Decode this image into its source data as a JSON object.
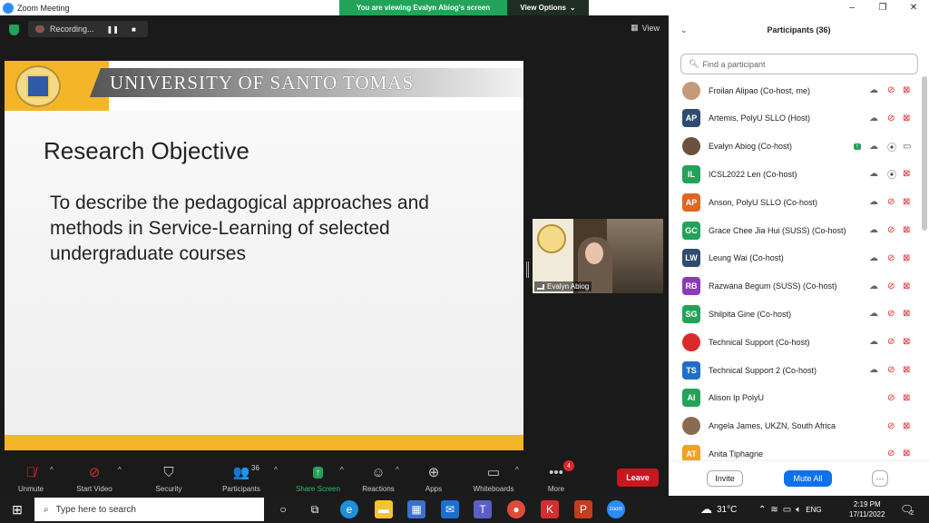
{
  "window": {
    "title": "Zoom Meeting",
    "viewing_banner": "You are viewing Evalyn Abiog's screen",
    "view_options": "View Options",
    "controls": [
      "–",
      "❐",
      "✕"
    ]
  },
  "meeting": {
    "recording_label": "Recording...",
    "view_label": "View"
  },
  "slide": {
    "university": "UNIVERSITY OF SANTO TOMAS",
    "title": "Research Objective",
    "body": "To describe the pedagogical approaches and methods in Service-Learning of selected undergraduate courses"
  },
  "thumbnail": {
    "name": "Evalyn Abiog"
  },
  "toolbar": {
    "unmute": "Unmute",
    "start_video": "Start Video",
    "security": "Security",
    "participants": "Participants",
    "participants_count": "36",
    "share_screen": "Share Screen",
    "reactions": "Reactions",
    "apps": "Apps",
    "whiteboards": "Whiteboards",
    "more": "More",
    "more_badge": "4",
    "leave": "Leave"
  },
  "panel": {
    "title": "Participants (36)",
    "search_placeholder": "Find a participant",
    "invite": "Invite",
    "mute_all": "Mute All",
    "more": "···"
  },
  "participants": [
    {
      "initials": "",
      "name": "Froilan Alipao (Co-host, me)",
      "color": "#c49a7a",
      "photo": true,
      "rec": true,
      "mic": "muted",
      "video": "off"
    },
    {
      "initials": "AP",
      "name": "Artemis, PolyU SLLO (Host)",
      "color": "#2f4b6e",
      "photo": false,
      "rec": true,
      "mic": "muted",
      "video": "off"
    },
    {
      "initials": "",
      "name": "Evalyn Abiog (Co-host)",
      "color": "#6b5040",
      "photo": true,
      "rec": true,
      "mic": "on",
      "video": "on",
      "sharing": true
    },
    {
      "initials": "IL",
      "name": "ICSL2022 Len (Co-host)",
      "color": "#23a35a",
      "photo": false,
      "rec": true,
      "mic": "on",
      "video": "off"
    },
    {
      "initials": "AP",
      "name": "Anson, PolyU SLLO (Co-host)",
      "color": "#e0661e",
      "photo": false,
      "rec": true,
      "mic": "muted",
      "video": "off"
    },
    {
      "initials": "GC",
      "name": "Grace Chee Jia Hui (SUSS) (Co-host)",
      "color": "#23a35a",
      "photo": false,
      "rec": true,
      "mic": "muted",
      "video": "off"
    },
    {
      "initials": "LW",
      "name": "Leung Wai (Co-host)",
      "color": "#2f4b6e",
      "photo": false,
      "rec": true,
      "mic": "muted",
      "video": "off"
    },
    {
      "initials": "RB",
      "name": "Razwana Begum (SUSS) (Co-host)",
      "color": "#8a3ab9",
      "photo": false,
      "rec": true,
      "mic": "muted",
      "video": "off"
    },
    {
      "initials": "SG",
      "name": "Shilpita Gine (Co-host)",
      "color": "#23a35a",
      "photo": false,
      "rec": true,
      "mic": "muted",
      "video": "off"
    },
    {
      "initials": "",
      "name": "Technical Support (Co-host)",
      "color": "#d92b2b",
      "photo": true,
      "rec": true,
      "mic": "muted",
      "video": "off"
    },
    {
      "initials": "TS",
      "name": "Technical Support 2 (Co-host)",
      "color": "#1f6fc8",
      "photo": false,
      "rec": true,
      "mic": "muted",
      "video": "off"
    },
    {
      "initials": "AI",
      "name": "Alison Ip PolyU",
      "color": "#23a35a",
      "photo": false,
      "rec": false,
      "mic": "muted",
      "video": "off"
    },
    {
      "initials": "",
      "name": "Angela James, UKZN, South Africa",
      "color": "#8a6a50",
      "photo": true,
      "rec": false,
      "mic": "muted",
      "video": "off"
    },
    {
      "initials": "AT",
      "name": "Anita Tiphagne",
      "color": "#f4a020",
      "photo": false,
      "rec": false,
      "mic": "muted",
      "video": "off"
    }
  ],
  "taskbar": {
    "search_placeholder": "Type here to search",
    "temperature": "31°C",
    "language": "ENG",
    "time": "2:19 PM",
    "date": "17/11/2022",
    "notif_count": "2"
  }
}
